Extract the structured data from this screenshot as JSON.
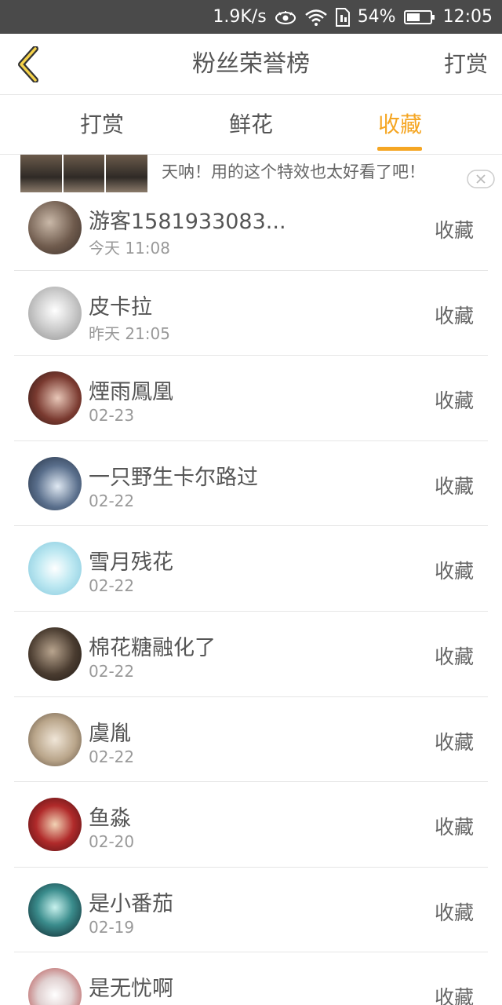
{
  "status_bar": {
    "speed": "1.9K/s",
    "battery": "54%",
    "time": "12:05"
  },
  "header": {
    "title": "粉丝荣誉榜",
    "right_action": "打赏"
  },
  "tabs": [
    {
      "label": "打赏",
      "active": false
    },
    {
      "label": "鲜花",
      "active": false
    },
    {
      "label": "收藏",
      "active": true
    }
  ],
  "ad": {
    "text": "天呐！用的这个特效也太好看了吧！"
  },
  "list": [
    {
      "name": "游客1581933083...",
      "time": "今天 11:08",
      "action": "收藏"
    },
    {
      "name": "皮卡拉",
      "time": "昨天 21:05",
      "action": "收藏"
    },
    {
      "name": "煙雨鳳凰",
      "time": "02-23",
      "action": "收藏"
    },
    {
      "name": "一只野生卡尔路过",
      "time": "02-22",
      "action": "收藏"
    },
    {
      "name": "雪月残花",
      "time": "02-22",
      "action": "收藏"
    },
    {
      "name": "棉花糖融化了",
      "time": "02-22",
      "action": "收藏"
    },
    {
      "name": "虞胤",
      "time": "02-22",
      "action": "收藏"
    },
    {
      "name": "鱼淼",
      "time": "02-20",
      "action": "收藏"
    },
    {
      "name": "是小番茄",
      "time": "02-19",
      "action": "收藏"
    },
    {
      "name": "是无忧啊",
      "time": "",
      "action": "收藏"
    }
  ],
  "colors": {
    "accent": "#f5a623",
    "status_bar": "#4a4a4a"
  }
}
